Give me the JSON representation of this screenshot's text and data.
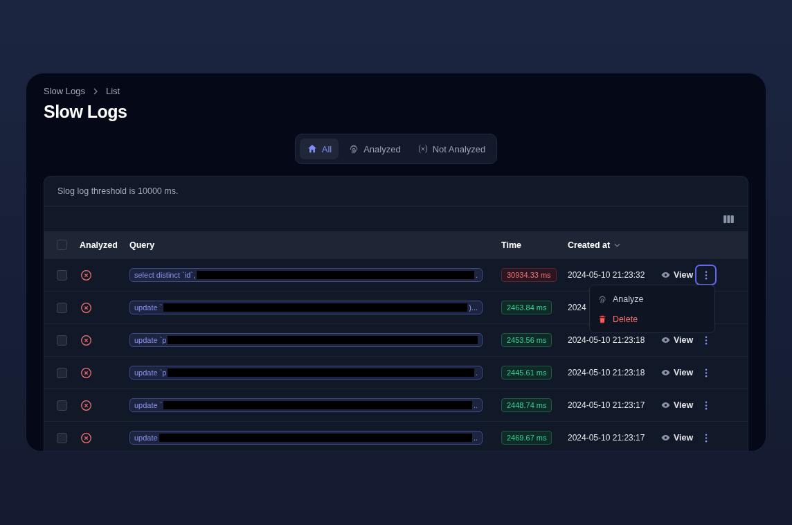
{
  "breadcrumb": [
    {
      "label": "Slow Logs"
    },
    {
      "label": "List"
    }
  ],
  "title": "Slow Logs",
  "tabs": [
    {
      "label": "All",
      "kind": "home",
      "selected": true
    },
    {
      "label": "Analyzed",
      "kind": "fingerprint",
      "selected": false
    },
    {
      "label": "Not Analyzed",
      "kind": "variable",
      "selected": false
    }
  ],
  "notice": "Slog log threshold is 10000 ms.",
  "table": {
    "select_all_checked": false,
    "columns": [
      "Analyzed",
      "Query",
      "Time",
      "Created at"
    ],
    "rows": [
      {
        "checked": false,
        "analyzed": false,
        "query_start": "select distinct `id`,",
        "query_end": ".",
        "time": "30934.33 ms",
        "slow": true,
        "created_at": "2024-05-10 21:23:32",
        "action": "View",
        "menu_open": true
      },
      {
        "checked": false,
        "analyzed": false,
        "query_start": "update `",
        "query_end": ")...",
        "time": "2463.84 ms",
        "slow": false,
        "created_at": "2024"
      },
      {
        "checked": false,
        "analyzed": false,
        "query_start": "update `p",
        "time": "2453.56 ms",
        "slow": false,
        "created_at": "2024-05-10 21:23:18",
        "action": "View",
        "menu_open": false
      },
      {
        "checked": false,
        "analyzed": false,
        "query_start": "update `p",
        "query_end": ".",
        "time": "2445.61 ms",
        "slow": false,
        "created_at": "2024-05-10 21:23:18",
        "action": "View",
        "menu_open": false
      },
      {
        "checked": false,
        "analyzed": false,
        "query_start": "update `",
        "query_end": "..",
        "time": "2448.74 ms",
        "slow": false,
        "created_at": "2024-05-10 21:23:17",
        "action": "View",
        "menu_open": false
      },
      {
        "checked": false,
        "analyzed": false,
        "query_start": "update",
        "query_end": "..",
        "time": "2469.67 ms",
        "slow": false,
        "created_at": "2024-05-10 21:23:17",
        "action": "View",
        "menu_open": false
      }
    ]
  },
  "menu": [
    {
      "label": "Analyze",
      "kind": "analyze"
    },
    {
      "label": "Delete",
      "kind": "delete"
    }
  ]
}
